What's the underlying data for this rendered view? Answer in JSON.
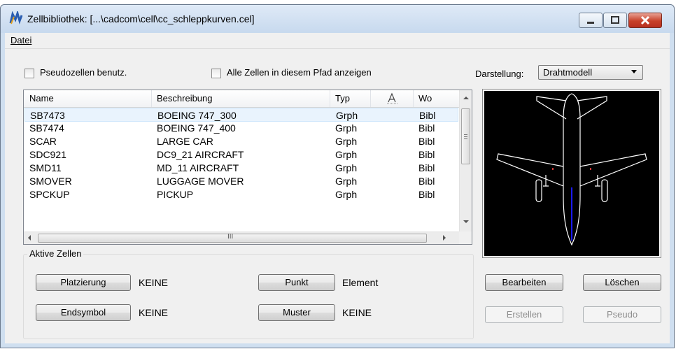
{
  "window": {
    "title": "Zellbibliothek: [...\\cadcom\\cell\\cc_schleppkurven.cel]",
    "menu": [
      {
        "label": "Datei"
      }
    ]
  },
  "options": {
    "pseudo_label": "Pseudozellen benutz.",
    "pseudo_checked": false,
    "all_cells_label": "Alle Zellen in diesem Pfad anzeigen",
    "all_cells_checked": false,
    "display_label": "Darstellung:",
    "display_value": "Drahtmodell"
  },
  "table": {
    "columns": [
      "Name",
      "Beschreibung",
      "Typ",
      "",
      "Wo"
    ],
    "rows": [
      {
        "name": "SB7473",
        "desc": "BOEING 747_300",
        "type": "Grph",
        "where": "Bibl",
        "selected": true
      },
      {
        "name": "SB7474",
        "desc": "BOEING 747_400",
        "type": "Grph",
        "where": "Bibl",
        "selected": false
      },
      {
        "name": "SCAR",
        "desc": "LARGE CAR",
        "type": "Grph",
        "where": "Bibl",
        "selected": false
      },
      {
        "name": "SDC921",
        "desc": "DC9_21 AIRCRAFT",
        "type": "Grph",
        "where": "Bibl",
        "selected": false
      },
      {
        "name": "SMD11",
        "desc": "MD_11 AIRCRAFT",
        "type": "Grph",
        "where": "Bibl",
        "selected": false
      },
      {
        "name": "SMOVER",
        "desc": "LUGGAGE MOVER",
        "type": "Grph",
        "where": "Bibl",
        "selected": false
      },
      {
        "name": "SPCKUP",
        "desc": "PICKUP",
        "type": "Grph",
        "where": "Bibl",
        "selected": false
      }
    ],
    "hscroll_grip": "III"
  },
  "active": {
    "title": "Aktive Zellen",
    "placement_label": "Platzierung",
    "placement_value": "KEINE",
    "point_label": "Punkt",
    "point_value": "Element",
    "endsymbol_label": "Endsymbol",
    "endsymbol_value": "KEINE",
    "pattern_label": "Muster",
    "pattern_value": "KEINE"
  },
  "buttons": {
    "edit": "Bearbeiten",
    "delete": "Löschen",
    "create": "Erstellen",
    "pseudo": "Pseudo"
  },
  "colors": {
    "preview_background": "#000000",
    "wireframe": "#ffffff",
    "axis_line": "#1a1aff",
    "marks": "#d23a3a"
  }
}
